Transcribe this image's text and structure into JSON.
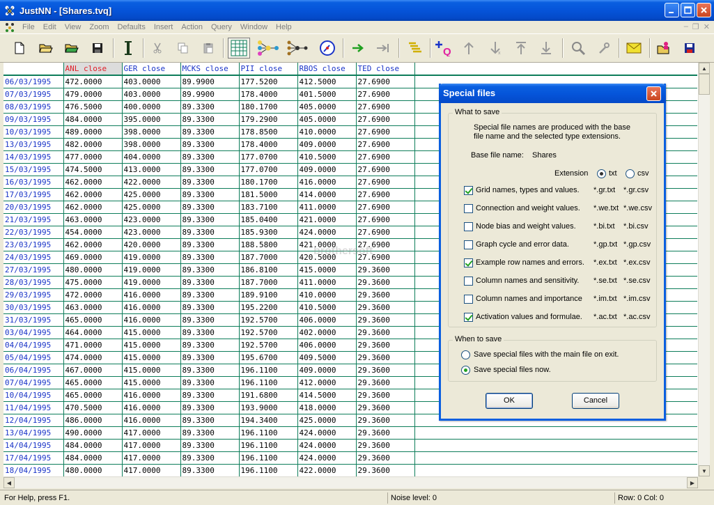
{
  "window": {
    "title": "JustNN - [Shares.tvq]"
  },
  "menu": [
    "File",
    "Edit",
    "View",
    "Zoom",
    "Defaults",
    "Insert",
    "Action",
    "Query",
    "Window",
    "Help"
  ],
  "grid": {
    "headers": [
      "ANL close",
      "GER close",
      "MCKS close",
      "PII close",
      "RBOS close",
      "TED close"
    ],
    "rows": [
      [
        "06/03/1995",
        "472.0000",
        "403.0000",
        "89.9900",
        "177.5200",
        "412.5000",
        "27.6900"
      ],
      [
        "07/03/1995",
        "479.0000",
        "403.0000",
        "89.9900",
        "178.4000",
        "401.5000",
        "27.6900"
      ],
      [
        "08/03/1995",
        "476.5000",
        "400.0000",
        "89.3300",
        "180.1700",
        "405.0000",
        "27.6900"
      ],
      [
        "09/03/1995",
        "484.0000",
        "395.0000",
        "89.3300",
        "179.2900",
        "405.0000",
        "27.6900"
      ],
      [
        "10/03/1995",
        "489.0000",
        "398.0000",
        "89.3300",
        "178.8500",
        "410.0000",
        "27.6900"
      ],
      [
        "13/03/1995",
        "482.0000",
        "398.0000",
        "89.3300",
        "178.4000",
        "409.0000",
        "27.6900"
      ],
      [
        "14/03/1995",
        "477.0000",
        "404.0000",
        "89.3300",
        "177.0700",
        "410.5000",
        "27.6900"
      ],
      [
        "15/03/1995",
        "474.5000",
        "413.0000",
        "89.3300",
        "177.0700",
        "409.0000",
        "27.6900"
      ],
      [
        "16/03/1995",
        "462.0000",
        "422.0000",
        "89.3300",
        "180.1700",
        "416.0000",
        "27.6900"
      ],
      [
        "17/03/1995",
        "462.0000",
        "425.0000",
        "89.3300",
        "181.5000",
        "414.0000",
        "27.6900"
      ],
      [
        "20/03/1995",
        "462.0000",
        "425.0000",
        "89.3300",
        "183.7100",
        "411.0000",
        "27.6900"
      ],
      [
        "21/03/1995",
        "463.0000",
        "423.0000",
        "89.3300",
        "185.0400",
        "421.0000",
        "27.6900"
      ],
      [
        "22/03/1995",
        "454.0000",
        "423.0000",
        "89.3300",
        "185.9300",
        "424.0000",
        "27.6900"
      ],
      [
        "23/03/1995",
        "462.0000",
        "420.0000",
        "89.3300",
        "188.5800",
        "421.0000",
        "27.6900"
      ],
      [
        "24/03/1995",
        "469.0000",
        "419.0000",
        "89.3300",
        "187.7000",
        "420.5000",
        "27.6900"
      ],
      [
        "27/03/1995",
        "480.0000",
        "419.0000",
        "89.3300",
        "186.8100",
        "415.0000",
        "29.3600"
      ],
      [
        "28/03/1995",
        "475.0000",
        "419.0000",
        "89.3300",
        "187.7000",
        "411.0000",
        "29.3600"
      ],
      [
        "29/03/1995",
        "472.0000",
        "416.0000",
        "89.3300",
        "189.9100",
        "410.0000",
        "29.3600"
      ],
      [
        "30/03/1995",
        "463.0000",
        "416.0000",
        "89.3300",
        "195.2200",
        "410.5000",
        "29.3600"
      ],
      [
        "31/03/1995",
        "465.0000",
        "416.0000",
        "89.3300",
        "192.5700",
        "406.0000",
        "29.3600"
      ],
      [
        "03/04/1995",
        "464.0000",
        "415.0000",
        "89.3300",
        "192.5700",
        "402.0000",
        "29.3600"
      ],
      [
        "04/04/1995",
        "471.0000",
        "415.0000",
        "89.3300",
        "192.5700",
        "406.0000",
        "29.3600"
      ],
      [
        "05/04/1995",
        "474.0000",
        "415.0000",
        "89.3300",
        "195.6700",
        "409.5000",
        "29.3600"
      ],
      [
        "06/04/1995",
        "467.0000",
        "415.0000",
        "89.3300",
        "196.1100",
        "409.0000",
        "29.3600"
      ],
      [
        "07/04/1995",
        "465.0000",
        "415.0000",
        "89.3300",
        "196.1100",
        "412.0000",
        "29.3600"
      ],
      [
        "10/04/1995",
        "465.0000",
        "416.0000",
        "89.3300",
        "191.6800",
        "414.5000",
        "29.3600"
      ],
      [
        "11/04/1995",
        "470.5000",
        "416.0000",
        "89.3300",
        "193.9000",
        "418.0000",
        "29.3600"
      ],
      [
        "12/04/1995",
        "486.0000",
        "416.0000",
        "89.3300",
        "194.3400",
        "425.0000",
        "29.3600"
      ],
      [
        "13/04/1995",
        "490.0000",
        "417.0000",
        "89.3300",
        "196.1100",
        "424.0000",
        "29.3600"
      ],
      [
        "14/04/1995",
        "484.0000",
        "417.0000",
        "89.3300",
        "196.1100",
        "424.0000",
        "29.3600"
      ],
      [
        "17/04/1995",
        "484.0000",
        "417.0000",
        "89.3300",
        "196.1100",
        "424.0000",
        "29.3600"
      ],
      [
        "18/04/1995",
        "480.0000",
        "417.0000",
        "89.3300",
        "196.1100",
        "422.0000",
        "29.3600"
      ]
    ]
  },
  "status": {
    "help": "For Help, press F1.",
    "noise": "Noise level: 0",
    "rowcol": "Row: 0  Col: 0"
  },
  "dialog": {
    "title": "Special files",
    "group1_label": "What to save",
    "desc": "Special file names are produced with the base file name and the selected type extensions.",
    "base_label": "Base file name:",
    "base_value": "Shares",
    "ext_label": "Extension",
    "ext_txt": "txt",
    "ext_csv": "csv",
    "items": [
      {
        "label": "Grid names, types and values.",
        "txt": "*.gr.txt",
        "csv": "*.gr.csv",
        "checked": true
      },
      {
        "label": "Connection and weight values.",
        "txt": "*.we.txt",
        "csv": "*.we.csv",
        "checked": false
      },
      {
        "label": "Node bias and weight values.",
        "txt": "*.bi.txt",
        "csv": "*.bi.csv",
        "checked": false
      },
      {
        "label": "Graph cycle and error data.",
        "txt": "*.gp.txt",
        "csv": "*.gp.csv",
        "checked": false
      },
      {
        "label": "Example row names and errors.",
        "txt": "*.ex.txt",
        "csv": "*.ex.csv",
        "checked": true
      },
      {
        "label": "Column names and sensitivity.",
        "txt": "*.se.txt",
        "csv": "*.se.csv",
        "checked": false
      },
      {
        "label": "Column names and importance",
        "txt": "*.im.txt",
        "csv": "*.im.csv",
        "checked": false
      },
      {
        "label": "Activation values and formulae.",
        "txt": "*.ac.txt",
        "csv": "*.ac.csv",
        "checked": true
      }
    ],
    "group2_label": "When to save",
    "opt_exit": "Save special files with the main file on exit.",
    "opt_now": "Save special files now.",
    "ok": "OK",
    "cancel": "Cancel"
  },
  "colors": {
    "accent": "#0a5fe0",
    "grid_line": "#0d7d5a",
    "header_text": "#1a34c8",
    "selected_header": "#e0202a"
  }
}
